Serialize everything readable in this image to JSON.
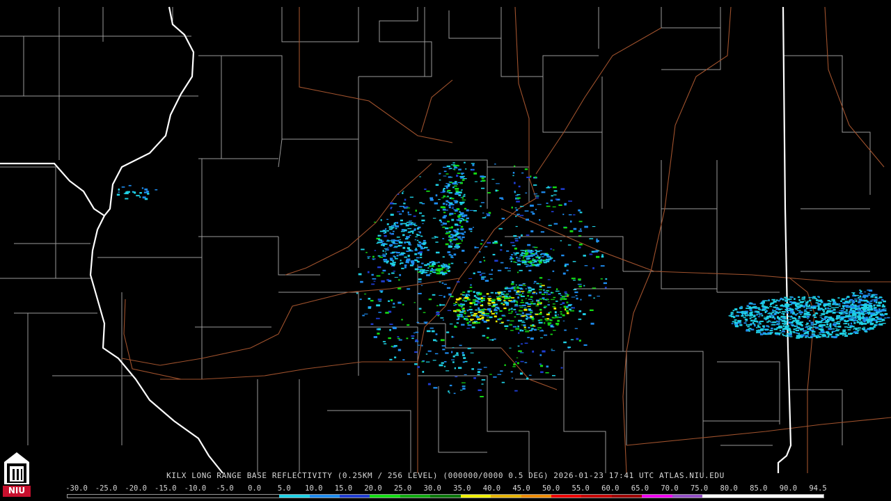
{
  "caption": "KILX LONG RANGE BASE REFLECTIVITY (0.25KM / 256 LEVEL) (000000/0000 0.5 DEG) 2026-01-23 17:41 UTC  ATLAS.NIU.EDU",
  "logo": {
    "text": "NIU",
    "icon": "university-tower-icon",
    "color": "#c8102e"
  },
  "colorbar": {
    "ticks": [
      "-30.0",
      "-25.0",
      "-20.0",
      "-15.0",
      "-10.0",
      "-5.0",
      "0.0",
      "5.0",
      "10.0",
      "15.0",
      "20.0",
      "25.0",
      "30.0",
      "35.0",
      "40.0",
      "45.0",
      "50.0",
      "55.0",
      "60.0",
      "65.0",
      "70.0",
      "75.0",
      "80.0",
      "85.0",
      "90.0",
      "94.5"
    ],
    "colors": [
      "#000000",
      "#000000",
      "#000000",
      "#000000",
      "#000000",
      "#000000",
      "#000000",
      "#1fd2e6",
      "#1e8cf0",
      "#1e3cd2",
      "#14dc14",
      "#0faa0f",
      "#0a780a",
      "#f0f000",
      "#e6b400",
      "#f08c00",
      "#f00000",
      "#c80000",
      "#a00000",
      "#f000f0",
      "#9650c8",
      "#ffffff",
      "#ffffff",
      "#ffffff",
      "#ffffff"
    ]
  },
  "map_colors": {
    "state_border": "#ffffff",
    "county_border": "#9a9a9a",
    "highway": "#a0522d",
    "background": "#000000"
  }
}
